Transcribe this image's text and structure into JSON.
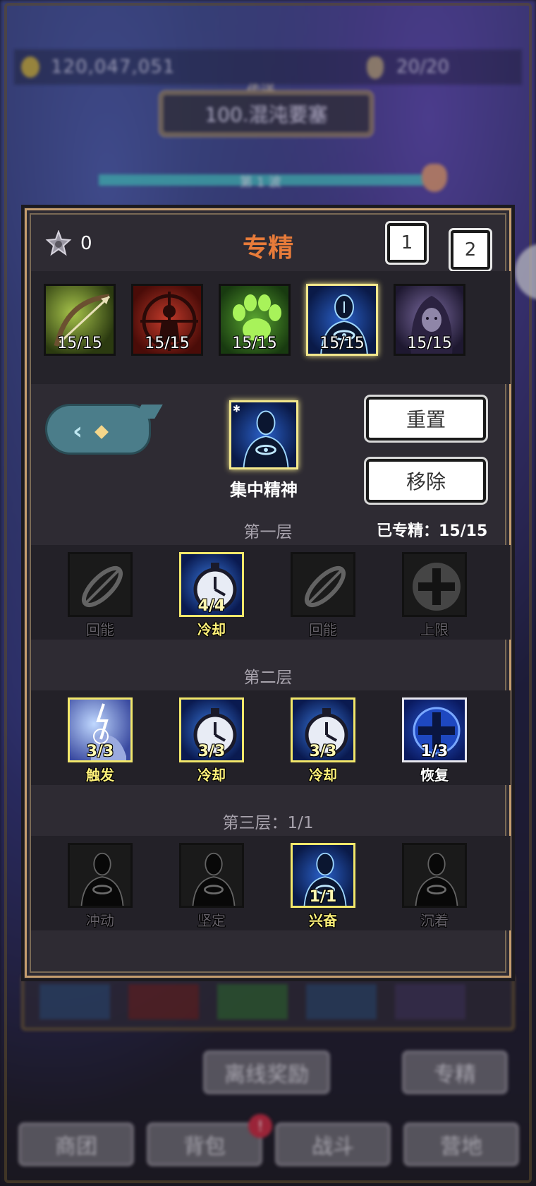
{
  "background": {
    "gold": "120,047,051",
    "energy": "20/20",
    "subtitle": "传送",
    "stage": "100.混沌要塞",
    "progress_label": "第 1 波"
  },
  "bottom": {
    "offline_rewards": "离线奖励",
    "specialization": "专精",
    "tabs": [
      "商团",
      "背包",
      "战斗",
      "营地"
    ],
    "badge": "!"
  },
  "panel": {
    "title": "专精",
    "points": "0",
    "pages": [
      "1",
      "2"
    ],
    "classes": [
      {
        "level": "15/15",
        "icon": "bow-icon"
      },
      {
        "level": "15/15",
        "icon": "target-warrior-icon"
      },
      {
        "level": "15/15",
        "icon": "paw-print-icon"
      },
      {
        "level": "15/15",
        "icon": "focus-figure-icon",
        "active": true
      },
      {
        "level": "15/15",
        "icon": "hooded-figure-icon"
      }
    ],
    "current": {
      "name": "集中精神",
      "icon": "focus-figure-icon"
    },
    "reset": "重置",
    "remove": "移除",
    "mastered_label": "已专精：",
    "mastered_value": "15/15",
    "tiers": [
      {
        "title": "第一层",
        "talents": [
          {
            "name": "回能",
            "count": "",
            "state": "off",
            "icon": "swirl-icon"
          },
          {
            "name": "冷却",
            "count": "4/4",
            "state": "on",
            "icon": "stopwatch-icon"
          },
          {
            "name": "回能",
            "count": "",
            "state": "off",
            "icon": "swirl-icon"
          },
          {
            "name": "上限",
            "count": "",
            "state": "off",
            "icon": "plus-shield-icon"
          }
        ]
      },
      {
        "title": "第二层",
        "talents": [
          {
            "name": "触发",
            "count": "3/3",
            "state": "on",
            "icon": "lightning-hand-icon"
          },
          {
            "name": "冷却",
            "count": "3/3",
            "state": "on",
            "icon": "stopwatch-icon"
          },
          {
            "name": "冷却",
            "count": "3/3",
            "state": "on",
            "icon": "stopwatch-icon"
          },
          {
            "name": "恢复",
            "count": "1/3",
            "state": "white",
            "icon": "plus-shield-icon"
          }
        ]
      },
      {
        "title": "第三层：",
        "title_count": "1/1",
        "talents": [
          {
            "name": "冲动",
            "count": "",
            "state": "off",
            "icon": "focus-figure-icon"
          },
          {
            "name": "坚定",
            "count": "",
            "state": "off",
            "icon": "focus-figure-icon"
          },
          {
            "name": "兴奋",
            "count": "1/1",
            "state": "on",
            "icon": "focus-figure-icon"
          },
          {
            "name": "沉着",
            "count": "",
            "state": "off",
            "icon": "focus-figure-icon"
          }
        ]
      }
    ]
  }
}
